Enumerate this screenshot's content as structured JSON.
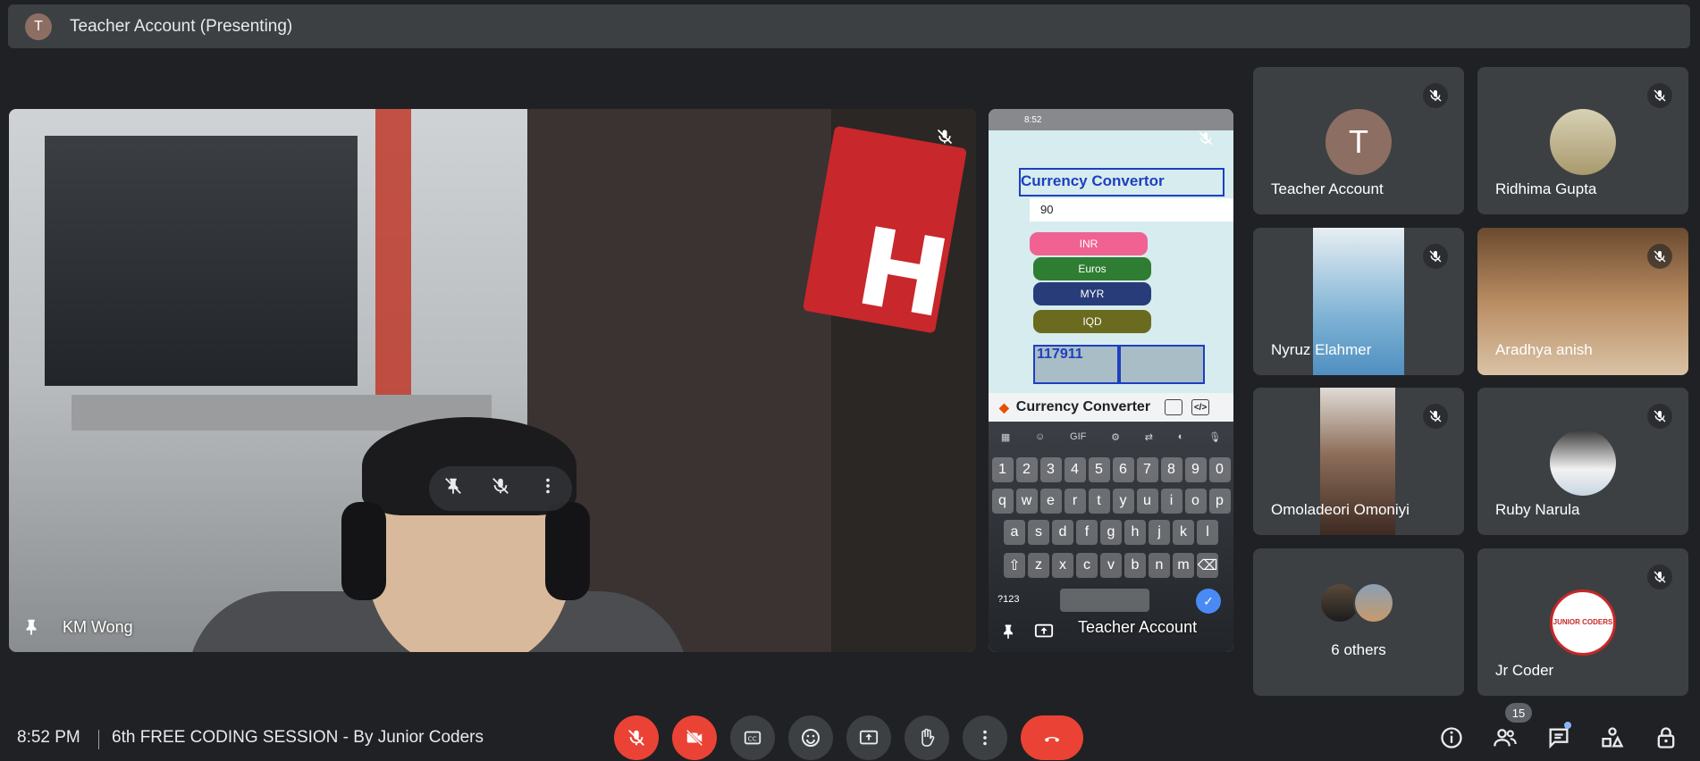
{
  "presenting_bar": {
    "avatar_letter": "T",
    "title": "Teacher Account (Presenting)"
  },
  "main_tile": {
    "name": "KM Wong"
  },
  "phone_tile": {
    "status_time": "8:52",
    "app_title": "Currency Convertor",
    "input_value": "90",
    "buttons": [
      {
        "label": "INR",
        "color": "#f06292"
      },
      {
        "label": "Euros",
        "color": "#2e7d32"
      },
      {
        "label": "MYR",
        "color": "#283c7a"
      },
      {
        "label": "IQD",
        "color": "#6b6b1f"
      }
    ],
    "result": "117911",
    "appbar_title": "Currency Converter",
    "keyboard": {
      "toolbar": [
        "GIF"
      ],
      "row1": [
        "1",
        "2",
        "3",
        "4",
        "5",
        "6",
        "7",
        "8",
        "9",
        "0"
      ],
      "row2": [
        "q",
        "w",
        "e",
        "r",
        "t",
        "y",
        "u",
        "i",
        "o",
        "p"
      ],
      "row3": [
        "a",
        "s",
        "d",
        "f",
        "g",
        "h",
        "j",
        "k",
        "l"
      ],
      "row4": [
        "z",
        "x",
        "c",
        "v",
        "b",
        "n",
        "m"
      ],
      "sym_key": "?123"
    },
    "name": "Teacher Account"
  },
  "participants": [
    {
      "name": "Teacher Account",
      "avatar_letter": "T",
      "avatar_color": "#8d6e63"
    },
    {
      "name": "Ridhima Gupta"
    },
    {
      "name": "Nyruz Elahmer"
    },
    {
      "name": "Aradhya anish"
    },
    {
      "name": "Omoladeori Omoniyi"
    },
    {
      "name": "Ruby Narula"
    },
    {
      "name": "6 others"
    },
    {
      "name": "Jr Coder",
      "logo_text": "JUNIOR CODERS"
    }
  ],
  "bottom_bar": {
    "time": "8:52 PM",
    "meeting_title": "6th FREE CODING SESSION - By Junior Coders",
    "people_count": "15"
  },
  "colors": {
    "background": "#202124",
    "tile": "#3c4043",
    "red": "#ea4335"
  }
}
